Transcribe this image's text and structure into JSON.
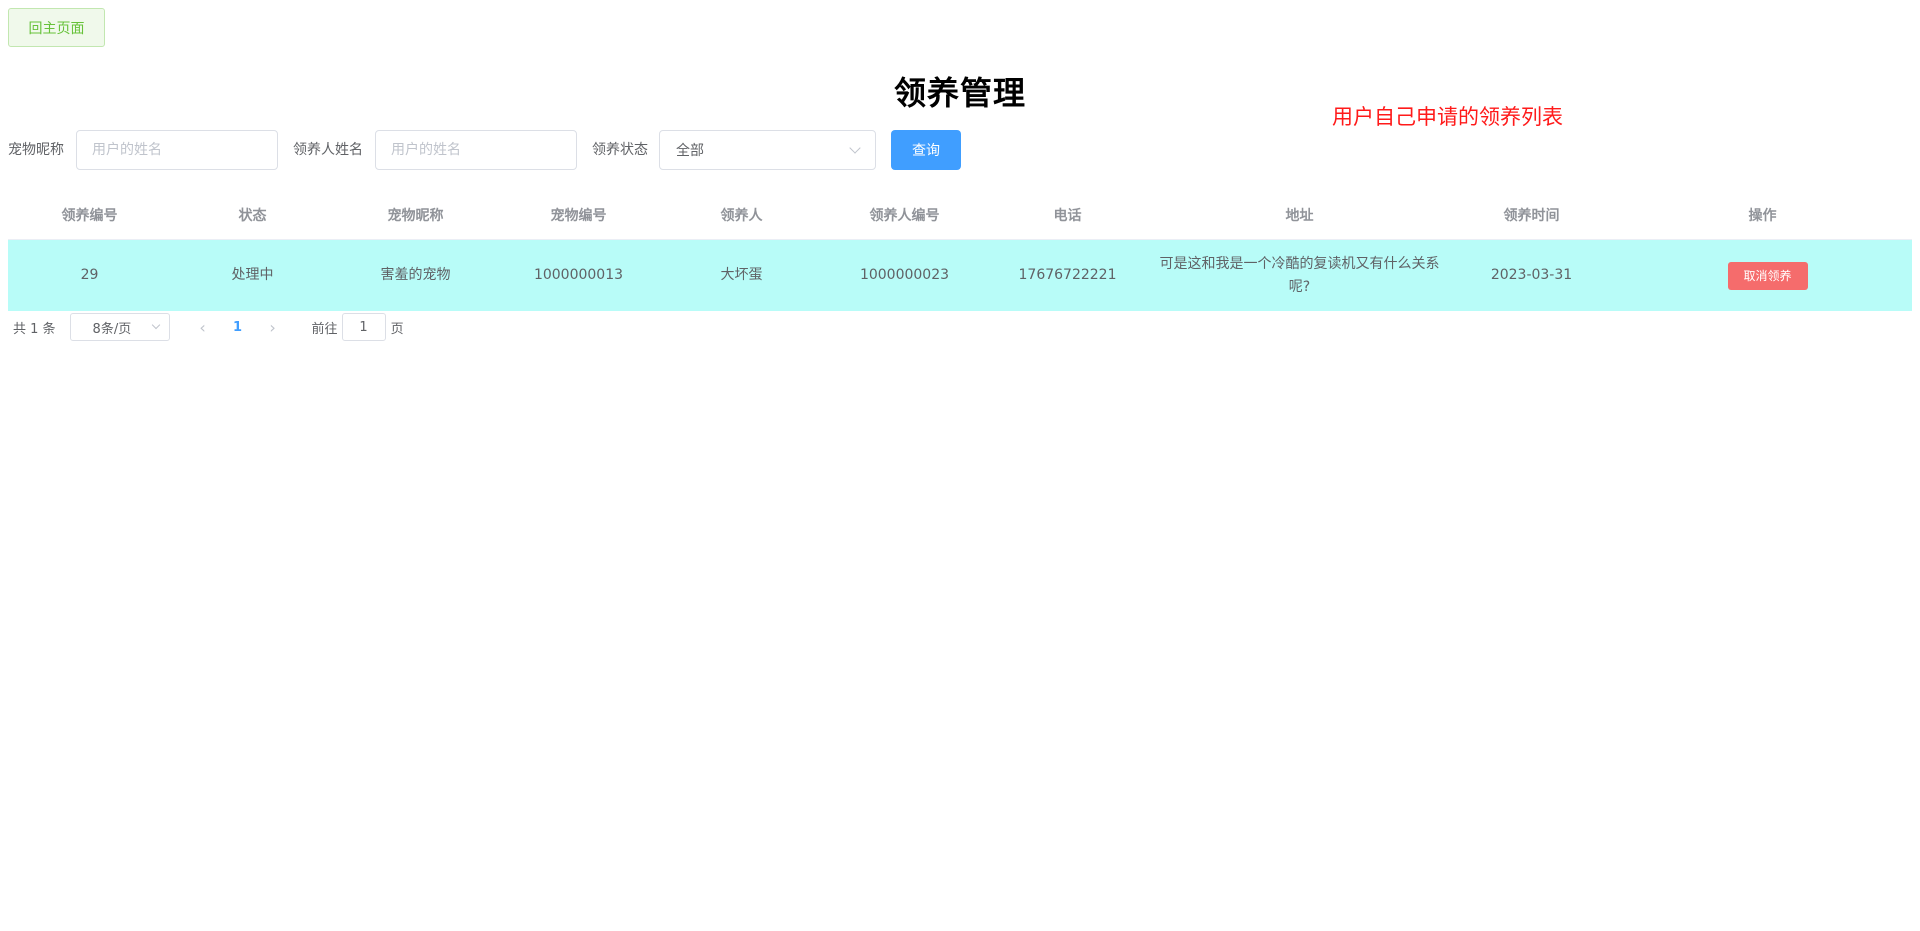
{
  "home_button": "回主页面",
  "page_title": "领养管理",
  "note": "用户自己申请的领养列表",
  "filters": {
    "pet_name_label": "宠物昵称",
    "pet_name_placeholder": "用户的姓名",
    "adopter_name_label": "领养人姓名",
    "adopter_name_placeholder": "用户的姓名",
    "status_label": "领养状态",
    "status_value": "全部",
    "query_button": "查询"
  },
  "table": {
    "headers": [
      "领养编号",
      "状态",
      "宠物昵称",
      "宠物编号",
      "领养人",
      "领养人编号",
      "电话",
      "地址",
      "领养时间",
      "操作"
    ],
    "rows": [
      {
        "id": "29",
        "status": "处理中",
        "pet_name": "害羞的宠物",
        "pet_id": "1000000013",
        "adopter": "大坏蛋",
        "adopter_id": "1000000023",
        "phone": "17676722221",
        "address": "可是这和我是一个冷酷的复读机又有什么关系呢?",
        "date": "2023-03-31",
        "action": "取消领养"
      }
    ]
  },
  "pagination": {
    "total": "共 1 条",
    "page_size": "8条/页",
    "current_page": "1",
    "goto_label": "前往",
    "goto_value": "1",
    "page_suffix": "页"
  },
  "colors": {
    "primary": "#409eff",
    "success_bg": "#f0f9eb",
    "danger": "#f56c6c",
    "row_highlight": "#b8fcf8",
    "note_red": "#ff1a1a"
  },
  "icons": [
    "chevron-down-icon",
    "chevron-left-icon",
    "chevron-right-icon"
  ]
}
